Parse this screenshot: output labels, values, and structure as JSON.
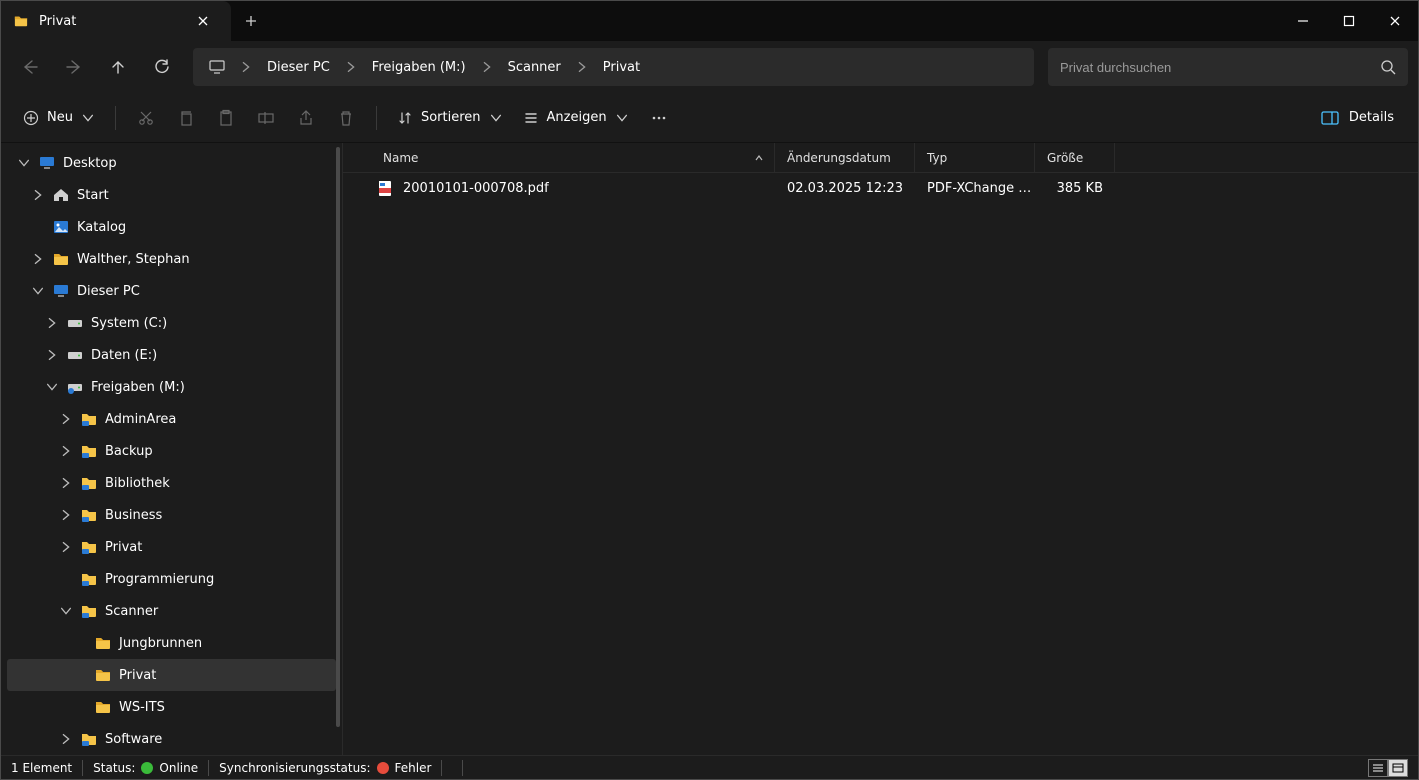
{
  "tab": {
    "title": "Privat"
  },
  "search": {
    "placeholder": "Privat durchsuchen"
  },
  "breadcrumb": [
    "Dieser PC",
    "Freigaben (M:)",
    "Scanner",
    "Privat"
  ],
  "toolbar": {
    "new": "Neu",
    "sort": "Sortieren",
    "view": "Anzeigen",
    "details": "Details"
  },
  "columns": {
    "name": "Name",
    "date": "Änderungsdatum",
    "type": "Typ",
    "size": "Größe"
  },
  "files": [
    {
      "name": "20010101-000708.pdf",
      "date": "02.03.2025 12:23",
      "type": "PDF-XChange Vie...",
      "size": "385 KB"
    }
  ],
  "tree": [
    {
      "label": "Desktop",
      "depth": 0,
      "caret": "down",
      "icon": "monitor"
    },
    {
      "label": "Start",
      "depth": 1,
      "caret": "right",
      "icon": "home"
    },
    {
      "label": "Katalog",
      "depth": 1,
      "caret": "none",
      "icon": "image"
    },
    {
      "label": "Walther, Stephan",
      "depth": 1,
      "caret": "right",
      "icon": "folder"
    },
    {
      "label": "Dieser PC",
      "depth": 1,
      "caret": "down",
      "icon": "pc"
    },
    {
      "label": "System (C:)",
      "depth": 2,
      "caret": "right",
      "icon": "drive"
    },
    {
      "label": "Daten (E:)",
      "depth": 2,
      "caret": "right",
      "icon": "drive"
    },
    {
      "label": "Freigaben (M:)",
      "depth": 2,
      "caret": "down",
      "icon": "netdrive"
    },
    {
      "label": "AdminArea",
      "depth": 3,
      "caret": "right",
      "icon": "sharefolder"
    },
    {
      "label": "Backup",
      "depth": 3,
      "caret": "right",
      "icon": "sharefolder"
    },
    {
      "label": "Bibliothek",
      "depth": 3,
      "caret": "right",
      "icon": "sharefolder"
    },
    {
      "label": "Business",
      "depth": 3,
      "caret": "right",
      "icon": "sharefolder"
    },
    {
      "label": "Privat",
      "depth": 3,
      "caret": "right",
      "icon": "sharefolder"
    },
    {
      "label": "Programmierung",
      "depth": 3,
      "caret": "none",
      "icon": "sharefolder"
    },
    {
      "label": "Scanner",
      "depth": 3,
      "caret": "down",
      "icon": "sharefolder"
    },
    {
      "label": "Jungbrunnen",
      "depth": 4,
      "caret": "none",
      "icon": "folder"
    },
    {
      "label": "Privat",
      "depth": 4,
      "caret": "none",
      "icon": "folder",
      "selected": true
    },
    {
      "label": "WS-ITS",
      "depth": 4,
      "caret": "none",
      "icon": "folder"
    },
    {
      "label": "Software",
      "depth": 3,
      "caret": "right",
      "icon": "sharefolder"
    }
  ],
  "status": {
    "count": "1 Element",
    "status_label": "Status:",
    "status_value": "Online",
    "sync_label": "Synchronisierungsstatus:",
    "sync_value": "Fehler"
  }
}
